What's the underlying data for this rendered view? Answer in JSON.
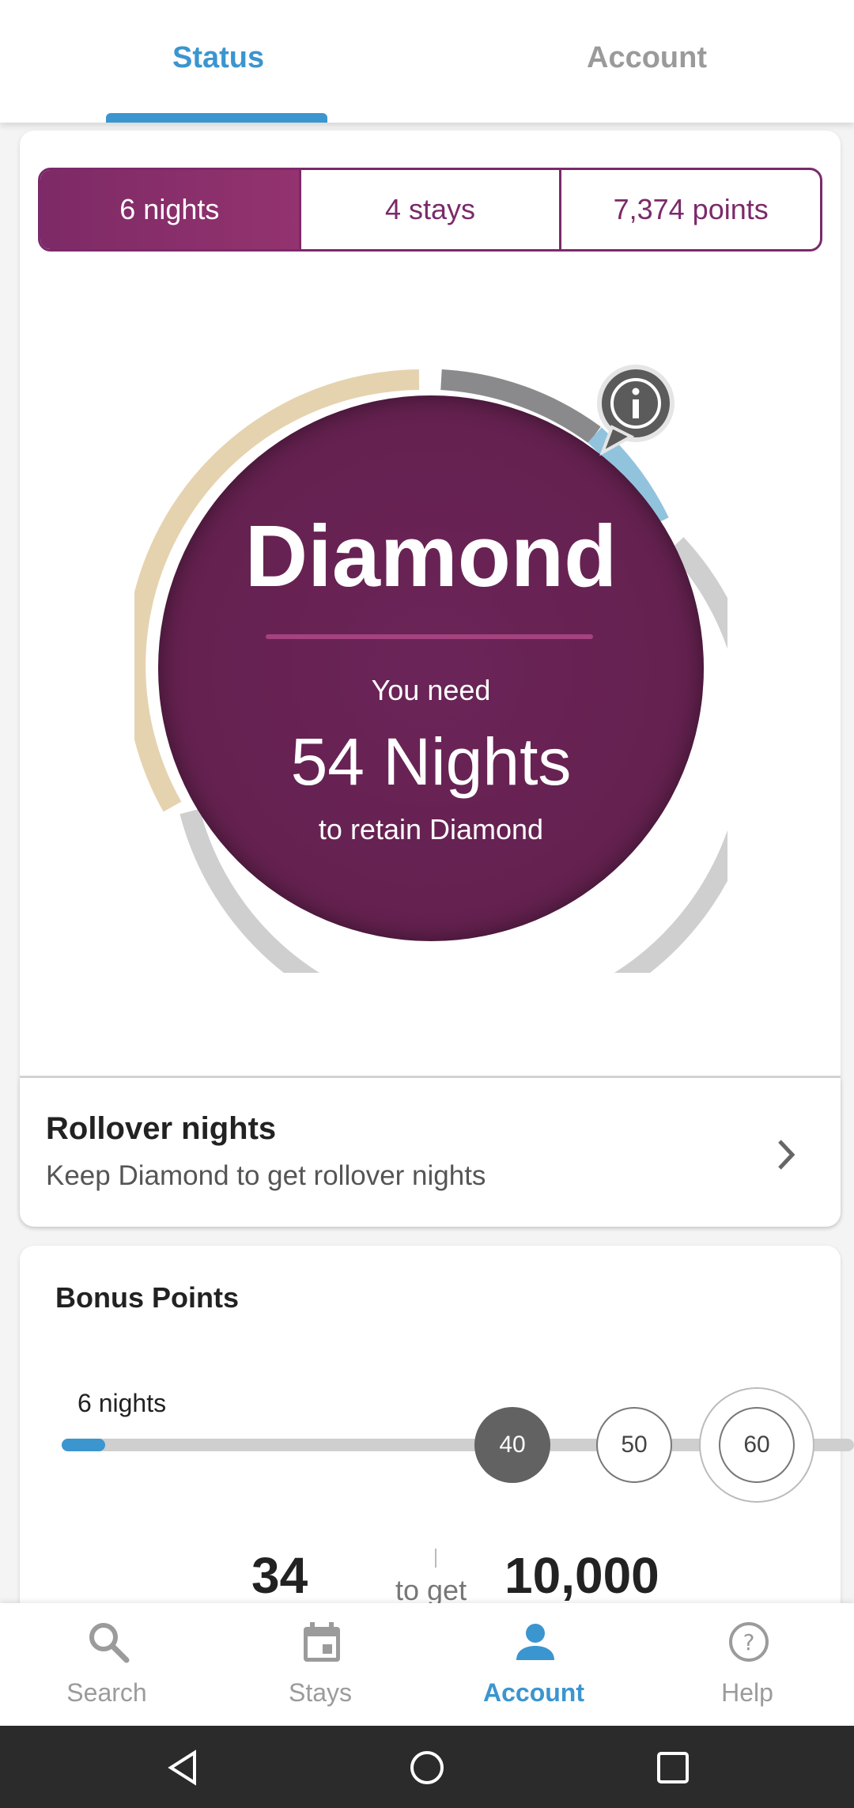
{
  "top_tabs": {
    "status": "Status",
    "account": "Account"
  },
  "segments": [
    "6 nights",
    "4 stays",
    "7,374 points"
  ],
  "status_ring": {
    "tier": "Diamond",
    "need_label": "You need",
    "need_value": "54 Nights",
    "need_sub": "to retain Diamond",
    "colors": {
      "circle": "#64214f",
      "earned": "#e5d3b0",
      "gray": "#8a8a8c",
      "blue": "#92c3dd",
      "remaining": "#cfcfcf"
    }
  },
  "rollover": {
    "title": "Rollover nights",
    "subtitle": "Keep Diamond to get rollover nights"
  },
  "bonus": {
    "title": "Bonus Points",
    "current": "6 nights",
    "progress_fraction": 0.055,
    "milestones": [
      "40",
      "50",
      "60"
    ],
    "remaining": "34",
    "to_get": "to get",
    "reward": "10,000"
  },
  "bottom_nav": [
    {
      "label": "Search",
      "icon": "search-icon"
    },
    {
      "label": "Stays",
      "icon": "calendar-icon"
    },
    {
      "label": "Account",
      "icon": "person-icon"
    },
    {
      "label": "Help",
      "icon": "help-icon"
    }
  ],
  "accent": "#3b95cf",
  "brand": "#7b2a6a"
}
